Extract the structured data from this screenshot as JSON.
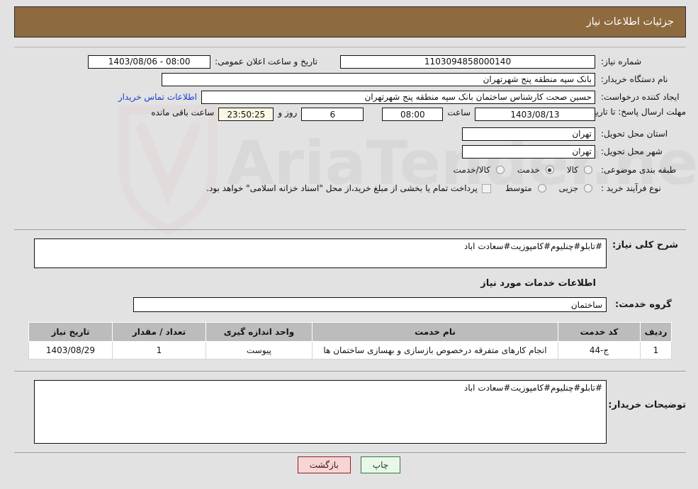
{
  "header": {
    "title": "جزئیات اطلاعات نیاز",
    "bar_color": "#8d6b3f"
  },
  "form": {
    "need_number_label": "شماره نیاز:",
    "need_number_value": "1103094858000140",
    "announce_label": "تاریخ و ساعت اعلان عمومی:",
    "announce_value": "08:00 - 1403/08/06",
    "buyer_org_label": "نام دستگاه خریدار:",
    "buyer_org_value": "بانک سپه منطقه پنج شهرتهران",
    "requester_label": "ایجاد کننده درخواست:",
    "requester_value": "حسین صحت کارشناس ساختمان بانک سپه منطقه پنج شهرتهران",
    "contact_link": "اطلاعات تماس خریدار",
    "deadline_label": "مهلت ارسال پاسخ: تا تاریخ:",
    "deadline_date": "1403/08/13",
    "hour_label": "ساعت",
    "deadline_time": "08:00",
    "days_remaining": "6",
    "days_label": "روز و",
    "time_remaining": "23:50:25",
    "remaining_label": "ساعت باقی مانده",
    "province_label": "استان محل تحویل:",
    "province_value": "تهران",
    "city_label": "شهر محل تحویل:",
    "city_value": "تهران",
    "category_label": "طبقه بندی موضوعی:",
    "category_options": [
      {
        "label": "کالا",
        "selected": false
      },
      {
        "label": "خدمت",
        "selected": true
      },
      {
        "label": "کالا/خدمت",
        "selected": false
      }
    ],
    "process_label": "نوع فرآیند خرید :",
    "process_options": [
      {
        "label": "جزیی",
        "selected": false
      },
      {
        "label": "متوسط",
        "selected": false
      }
    ],
    "treasury_note": "پرداخت تمام یا بخشی از مبلغ خرید،از محل \"اسناد خزانه اسلامی\" خواهد بود.",
    "treasury_checked": false
  },
  "description": {
    "general_label": "شرح کلی نیاز:",
    "general_value": "#تابلو#چنلیوم#کامپوزیت#سعادت اباد",
    "services_heading": "اطلاعات خدمات مورد نیاز",
    "service_group_label": "گروه خدمت:",
    "service_group_value": "ساختمان"
  },
  "table": {
    "columns": [
      "ردیف",
      "کد خدمت",
      "نام خدمت",
      "واحد اندازه گیری",
      "تعداد / مقدار",
      "تاریخ نیاز"
    ],
    "rows": [
      {
        "index": "1",
        "code": "ج-44",
        "name": "انجام کارهای متفرقه درخصوص بازسازی و بهسازی ساختمان ها",
        "unit": "پیوست",
        "quantity": "1",
        "need_date": "1403/08/29"
      }
    ]
  },
  "buyer_notes": {
    "label": "توضیحات خریدار:",
    "value": "#تابلو#چنلیوم#کامپوزیت#سعادت اباد"
  },
  "footer": {
    "print_label": "چاپ",
    "back_label": "بازگشت"
  },
  "watermark": {
    "text": "AriaTender.net"
  }
}
